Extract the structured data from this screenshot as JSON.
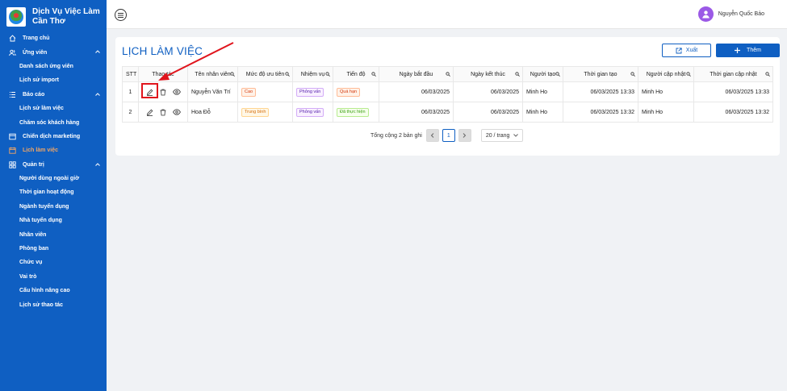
{
  "app": {
    "name_line1": "Dịch Vụ Việc Làm",
    "name_line2": "Cần Thơ"
  },
  "sidebar": {
    "items": [
      {
        "label": "Trang chủ",
        "level": "top",
        "icon": "home-icon"
      },
      {
        "label": "Ứng viên",
        "level": "top",
        "icon": "users-icon",
        "expanded": true
      },
      {
        "label": "Danh sách ứng viên",
        "level": "sub"
      },
      {
        "label": "Lịch sử import",
        "level": "sub"
      },
      {
        "label": "Báo cáo",
        "level": "top",
        "icon": "report-list-icon",
        "expanded": true
      },
      {
        "label": "Lịch sử làm việc",
        "level": "sub"
      },
      {
        "label": "Chăm sóc khách hàng",
        "level": "sub"
      },
      {
        "label": "Chiến dịch marketing",
        "level": "top",
        "icon": "campaign-icon"
      },
      {
        "label": "Lịch làm việc",
        "level": "top",
        "icon": "calendar-icon",
        "active": true
      },
      {
        "label": "Quản trị",
        "level": "top",
        "icon": "admin-grid-icon",
        "expanded": true
      },
      {
        "label": "Người dùng ngoài giờ",
        "level": "sub"
      },
      {
        "label": "Thời gian hoạt động",
        "level": "sub"
      },
      {
        "label": "Ngành tuyển dụng",
        "level": "sub"
      },
      {
        "label": "Nhà tuyển dụng",
        "level": "sub"
      },
      {
        "label": "Nhân viên",
        "level": "sub"
      },
      {
        "label": "Phòng ban",
        "level": "sub"
      },
      {
        "label": "Chức vụ",
        "level": "sub"
      },
      {
        "label": "Vai trò",
        "level": "sub"
      },
      {
        "label": "Cấu hình nâng cao",
        "level": "sub"
      },
      {
        "label": "Lịch sử thao tác",
        "level": "sub"
      }
    ]
  },
  "header": {
    "user_name": "Nguyễn Quốc Bảo"
  },
  "page": {
    "title": "LỊCH LÀM VIỆC",
    "export_label": "Xuất",
    "add_label": "Thêm"
  },
  "table": {
    "columns": [
      "STT",
      "Thao tác",
      "Tên nhân viên",
      "Mức độ ưu tiên",
      "Nhiệm vụ",
      "Tiến độ",
      "Ngày bắt đầu",
      "Ngày kết thúc",
      "Người tạo",
      "Thời gian tạo",
      "Người cập nhật",
      "Thời gian cập nhật"
    ],
    "rows": [
      {
        "stt": "1",
        "name": "Nguyễn Văn Trí",
        "priority": "Cao",
        "priority_color": "red",
        "task": "Phỏng vấn",
        "progress": "Quá hạn",
        "progress_color": "red",
        "start": "06/03/2025",
        "end": "06/03/2025",
        "creator": "Minh Ho",
        "created": "06/03/2025 13:33",
        "updater": "Minh Ho",
        "updated": "06/03/2025 13:33"
      },
      {
        "stt": "2",
        "name": "Hoa Đỗ",
        "priority": "Trung bình",
        "priority_color": "orange",
        "task": "Phỏng vấn",
        "progress": "Đã thực hiện",
        "progress_color": "green",
        "start": "06/03/2025",
        "end": "06/03/2025",
        "creator": "Minh Ho",
        "created": "06/03/2025 13:32",
        "updater": "Minh Ho",
        "updated": "06/03/2025 13:32"
      }
    ]
  },
  "pagination": {
    "total_text": "Tổng cộng 2 bản ghi",
    "current_page": "1",
    "page_size": "20 / trang"
  },
  "colors": {
    "primary": "#0f5fc2",
    "active_menu": "#f3a664",
    "annotation": "#e0141c"
  }
}
